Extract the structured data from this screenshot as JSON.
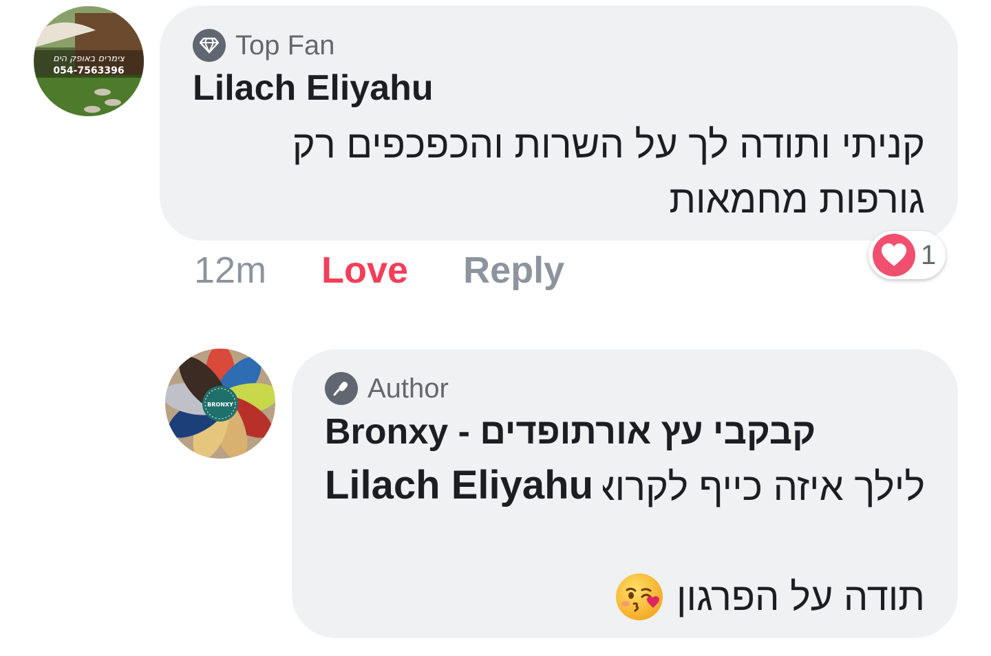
{
  "comment": {
    "badge": "Top Fan",
    "author": "Lilach Eliyahu",
    "text": "קניתי ותודה לך על השרות והכפכפים רק גורפות מחמאות",
    "avatar_caption_line1": "צימרים באופק הים",
    "avatar_caption_line2": "054-7563396",
    "time": "12m",
    "love_label": "Love",
    "reply_label": "Reply",
    "reaction_count": "1",
    "reaction_icon": "heart-icon"
  },
  "reply": {
    "badge": "Author",
    "author": "Bronxy - קבקבי עץ אורתופדים",
    "mention": "Lilach Eliyahu",
    "text_part1": "לילך איזה כייף לקרוא!",
    "text_part2": "תודה על הפרגון",
    "avatar_label": "BRONXY",
    "emoji": "kissing-face-emoji"
  },
  "colors": {
    "bubble": "#eff1f3",
    "love": "#f33e58",
    "muted": "#8d949e",
    "heart": "#f0506e"
  }
}
